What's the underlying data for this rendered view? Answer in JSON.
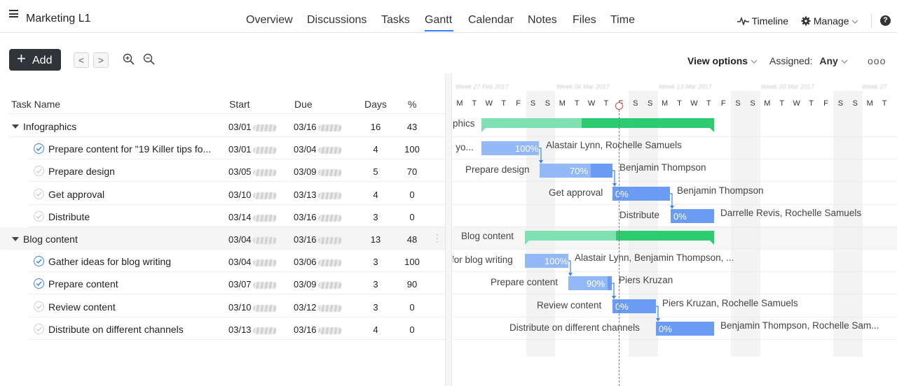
{
  "header": {
    "project_title": "Marketing L1",
    "tabs": [
      {
        "label": "Overview"
      },
      {
        "label": "Discussions"
      },
      {
        "label": "Tasks"
      },
      {
        "label": "Gantt"
      },
      {
        "label": "Calendar"
      },
      {
        "label": "Notes"
      },
      {
        "label": "Files"
      },
      {
        "label": "Time"
      }
    ],
    "active_tab": "Gantt",
    "timeline_label": "Timeline",
    "manage_label": "Manage",
    "help_label": "?"
  },
  "toolbar": {
    "add_label": "Add",
    "prev_label": "<",
    "next_label": ">",
    "view_options_label": "View options",
    "assigned_label": "Assigned:",
    "assigned_value": "Any",
    "more_label": "ooo"
  },
  "columns": {
    "name": "Task Name",
    "start": "Start",
    "due": "Due",
    "days": "Days",
    "percent": "%"
  },
  "rows": [
    {
      "name": "Infographics",
      "start": "03/01",
      "due": "03/16",
      "days": "16",
      "pct": "43",
      "group": true
    },
    {
      "name": "Prepare content for \"19 Killer tips fo...",
      "start": "03/01",
      "due": "03/04",
      "days": "4",
      "pct": "100",
      "done": true
    },
    {
      "name": "Prepare design",
      "start": "03/05",
      "due": "03/09",
      "days": "5",
      "pct": "70",
      "done": false
    },
    {
      "name": "Get approval",
      "start": "03/10",
      "due": "03/13",
      "days": "4",
      "pct": "0",
      "done": false
    },
    {
      "name": "Distribute",
      "start": "03/14",
      "due": "03/16",
      "days": "3",
      "pct": "0",
      "done": false
    },
    {
      "name": "Blog content",
      "start": "03/04",
      "due": "03/16",
      "days": "13",
      "pct": "48",
      "group": true
    },
    {
      "name": "Gather ideas for blog writing",
      "start": "03/04",
      "due": "03/06",
      "days": "3",
      "pct": "100",
      "done": true
    },
    {
      "name": "Prepare content",
      "start": "03/07",
      "due": "03/09",
      "days": "3",
      "pct": "90",
      "done": true
    },
    {
      "name": "Review content",
      "start": "03/10",
      "due": "03/12",
      "days": "3",
      "pct": "0",
      "done": false
    },
    {
      "name": "Distribute on different channels",
      "start": "03/13",
      "due": "03/16",
      "days": "4",
      "pct": "0",
      "done": false
    }
  ],
  "gantt": {
    "day_letters": [
      "M",
      "T",
      "W",
      "T",
      "F",
      "S",
      "S",
      "M",
      "T",
      "W",
      "T",
      "F",
      "S",
      "S",
      "M",
      "T",
      "W",
      "T",
      "F",
      "S",
      "S",
      "M",
      "T",
      "W",
      "T",
      "F",
      "S",
      "S",
      "M",
      "T"
    ],
    "bars": [
      {
        "label": "phics",
        "pct_text": "",
        "assignees": ""
      },
      {
        "label": "r yo...",
        "pct_text": "100%",
        "assignees": "Alastair Lynn, Rochelle Samuels"
      },
      {
        "label": "Prepare design",
        "pct_text": "70%",
        "assignees": "Benjamin Thompson"
      },
      {
        "label": "Get approval",
        "pct_text": "0%",
        "assignees": "Benjamin Thompson"
      },
      {
        "label": "Distribute",
        "pct_text": "0%",
        "assignees": "Darrelle Revis, Rochelle Samuels"
      },
      {
        "label": "Blog content",
        "pct_text": "",
        "assignees": ""
      },
      {
        "label": "for blog writing",
        "pct_text": "100%",
        "assignees": "Alastair Lynn, Benjamin Thompson, ..."
      },
      {
        "label": "Prepare content",
        "pct_text": "90%",
        "assignees": "Piers Kruzan"
      },
      {
        "label": "Review content",
        "pct_text": "0%",
        "assignees": "Piers Kruzan, Rochelle Samuels"
      },
      {
        "label": "Distribute on different channels",
        "pct_text": "0%",
        "assignees": "Benjamin Thompson, Rochelle Sam..."
      }
    ]
  },
  "colors": {
    "accent": "#3b82f6",
    "bar_light": "#93b8f8",
    "bar_blue": "#6a9cf4",
    "summary_light": "#7fe0b2",
    "summary_dark": "#2ecc71",
    "today_marker": "#e0463c"
  }
}
